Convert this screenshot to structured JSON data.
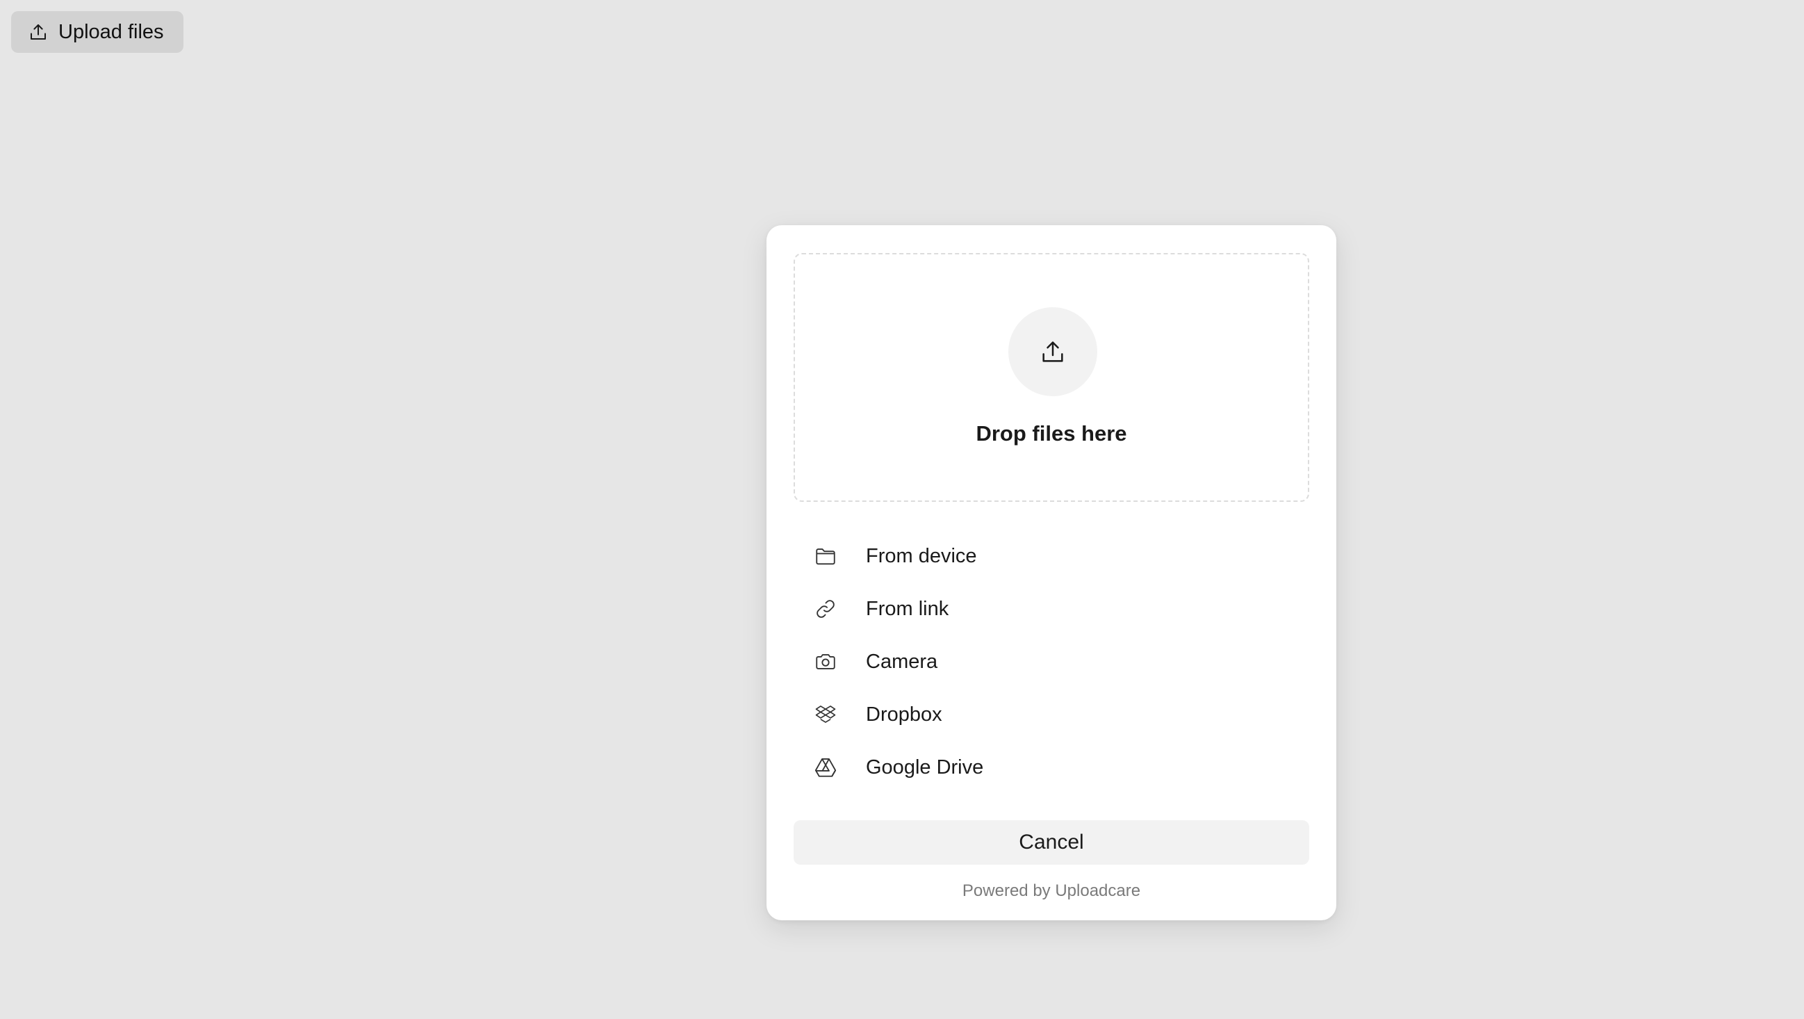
{
  "toolbar": {
    "upload_label": "Upload files",
    "upload_icon": "upload-icon"
  },
  "modal": {
    "drop_icon": "upload-icon",
    "drop_text": "Drop files here",
    "sources": [
      {
        "label": "From device",
        "icon": "folder-icon"
      },
      {
        "label": "From link",
        "icon": "link-icon"
      },
      {
        "label": "Camera",
        "icon": "camera-icon"
      },
      {
        "label": "Dropbox",
        "icon": "dropbox-icon"
      },
      {
        "label": "Google Drive",
        "icon": "google-drive-icon"
      }
    ],
    "cancel_label": "Cancel",
    "powered_by": "Powered by Uploadcare"
  },
  "colors": {
    "page_background": "#e6e6e6",
    "modal_background": "#ffffff",
    "upload_button_background": "#d2d2d2",
    "cancel_button_background": "#f2f2f2",
    "drop_circle_background": "#f2f2f2",
    "muted_text": "#7a7a7a"
  }
}
